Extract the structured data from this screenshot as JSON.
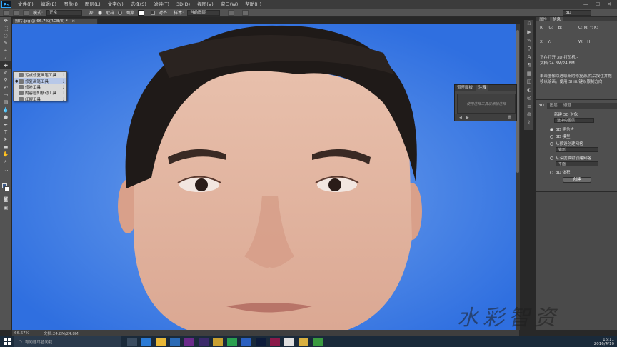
{
  "app": {
    "logo": "Ps"
  },
  "menu": [
    "文件(F)",
    "编辑(E)",
    "图像(I)",
    "图层(L)",
    "文字(Y)",
    "选择(S)",
    "滤镜(T)",
    "3D(D)",
    "视图(V)",
    "窗口(W)",
    "帮助(H)"
  ],
  "window_buttons": [
    "—",
    "☐",
    "✕"
  ],
  "options": {
    "mode_label": "模式:",
    "mode_value": "正常",
    "source_label": "源:",
    "source_sampled": "取样",
    "source_pattern": "图案",
    "aligned_label": "对齐",
    "sample_label": "样本:",
    "sample_value": "当前图层",
    "workspace": "3D"
  },
  "document": {
    "tab_title": "照片.jpg @ 66.7%(RGB/8) *",
    "close": "×"
  },
  "tool_flyout": {
    "items": [
      {
        "label": "污点修复画笔工具",
        "key": "J",
        "selected": false
      },
      {
        "label": "修复画笔工具",
        "key": "J",
        "selected": true
      },
      {
        "label": "修补工具",
        "key": "J",
        "selected": false
      },
      {
        "label": "内容感知移动工具",
        "key": "J",
        "selected": false
      },
      {
        "label": "红眼工具",
        "key": "J",
        "selected": false
      }
    ]
  },
  "status": {
    "zoom": "66.67%",
    "doc": "文档:24.8M/24.8M"
  },
  "float_panel": {
    "tabs": [
      "调整面板",
      "注释"
    ],
    "placeholder": "使用注释工具以添加注释"
  },
  "right_panel": {
    "top_tabs": [
      "属性",
      "信息"
    ],
    "info_text_1": "正在打开 3D 打印机 -",
    "info_text_2": "文档:24.8M/24.8M",
    "info_hint_1": "单击图像以选取新的修复源,然后按住并拖",
    "info_hint_2": "移以绘画。使用 Shift 键以限制方向",
    "mid_tabs": [
      "3D",
      "图层",
      "通道"
    ],
    "new_3d_label": "新建 3D 对象",
    "layer_select": "选中的图层",
    "options_3d": [
      {
        "label": "3D 明信片",
        "checked": true
      },
      {
        "label": "3D 模型",
        "checked": false
      },
      {
        "label": "从预设创建网格",
        "checked": false
      },
      {
        "label": "从深度映射创建网格",
        "checked": false
      },
      {
        "label": "3D 体积",
        "checked": false
      }
    ],
    "preset_select": "锥形",
    "depth_select": "平面",
    "create_button": "创建"
  },
  "watermark": "水彩智资",
  "taskbar": {
    "search_placeholder": "有问题尽管问我",
    "clock_time": "16:11",
    "clock_date": "2016/4/10",
    "apps": [
      {
        "name": "taskview",
        "color": "#3a4c60"
      },
      {
        "name": "edge",
        "color": "#2a7ad5"
      },
      {
        "name": "explorer",
        "color": "#e8b838"
      },
      {
        "name": "store",
        "color": "#2a6ab5"
      },
      {
        "name": "after-effects",
        "color": "#6a2a8a"
      },
      {
        "name": "premiere",
        "color": "#3a2a6a"
      },
      {
        "name": "media",
        "color": "#c8a030"
      },
      {
        "name": "app-green",
        "color": "#2aa050"
      },
      {
        "name": "app-blue",
        "color": "#2a60c0"
      },
      {
        "name": "photoshop",
        "color": "#0d1b3a"
      },
      {
        "name": "illustrator",
        "color": "#8a1a4a"
      },
      {
        "name": "document",
        "color": "#e0e0e0"
      },
      {
        "name": "folder",
        "color": "#d8b040"
      },
      {
        "name": "image",
        "color": "#3a9a40"
      }
    ]
  }
}
